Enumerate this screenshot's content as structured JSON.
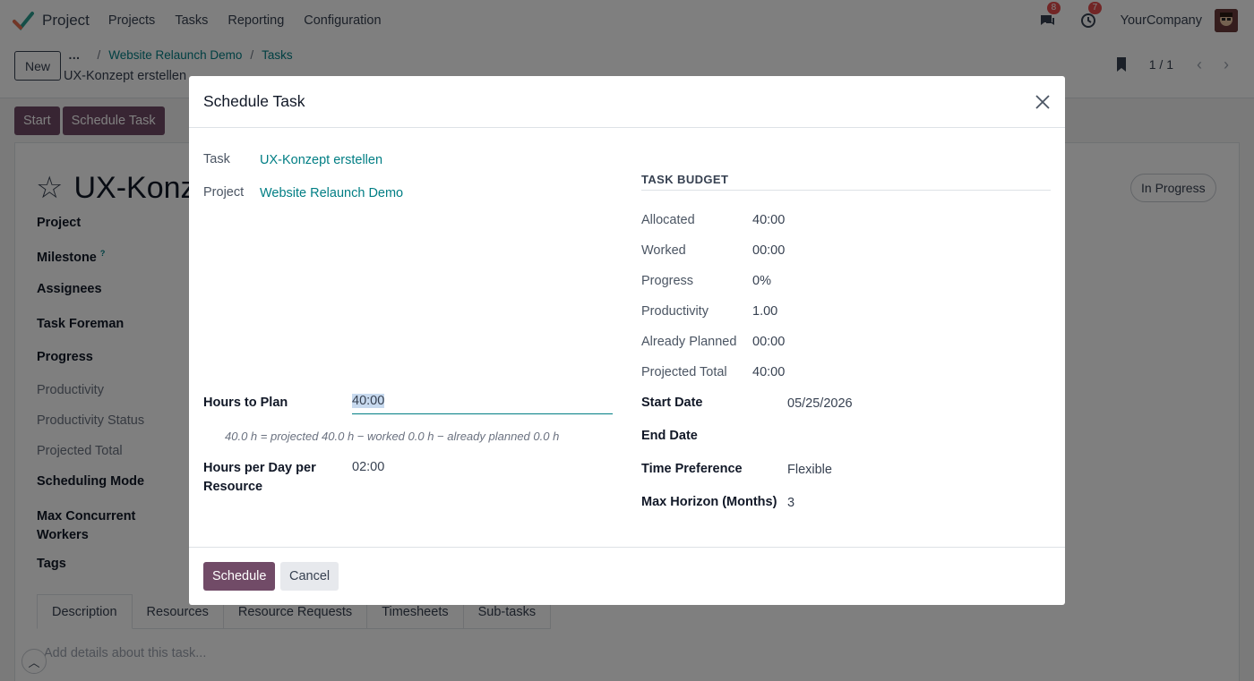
{
  "navbar": {
    "app_name": "Project",
    "menu": [
      "Projects",
      "Tasks",
      "Reporting",
      "Configuration"
    ],
    "messages_count": "8",
    "activities_count": "7",
    "company": "YourCompany"
  },
  "control_panel": {
    "new_label": "New",
    "breadcrumb_more": "…",
    "breadcrumbs": [
      "Website Relaunch Demo",
      "Tasks"
    ],
    "record_name": "UX-Konzept erstellen",
    "pager": "1 / 1"
  },
  "form": {
    "buttons": [
      "Start",
      "Schedule Task"
    ],
    "title": "UX-Konz",
    "status": "In Progress",
    "fields": [
      "Project",
      "Milestone",
      "Assignees",
      "Task Foreman",
      "Progress",
      "Productivity",
      "Productivity Status",
      "Projected Total",
      "Scheduling Mode",
      "Max Concurrent Workers",
      "Tags"
    ],
    "milestone_help": "?",
    "tabs": [
      "Description",
      "Resources",
      "Resource Requests",
      "Timesheets",
      "Sub-tasks"
    ],
    "description_placeholder": "Add details about this task..."
  },
  "dialog": {
    "title": "Schedule Task",
    "task_label": "Task",
    "task_value": "UX-Konzept erstellen",
    "project_label": "Project",
    "project_value": "Website Relaunch Demo",
    "hours_to_plan_label": "Hours to Plan",
    "hours_to_plan_value": "40:00",
    "hours_hint": "40.0 h = projected 40.0 h − worked 0.0 h − already planned 0.0 h",
    "hours_per_day_label": "Hours per Day per Resource",
    "hours_per_day_value": "02:00",
    "budget": {
      "heading": "TASK BUDGET",
      "rows": [
        {
          "label": "Allocated",
          "value": "40:00"
        },
        {
          "label": "Worked",
          "value": "00:00"
        },
        {
          "label": "Progress",
          "value": "0%"
        },
        {
          "label": "Productivity",
          "value": "1.00"
        },
        {
          "label": "Already Planned",
          "value": "00:00"
        },
        {
          "label": "Projected Total",
          "value": "40:00"
        }
      ]
    },
    "start_date_label": "Start Date",
    "start_date_value": "05/25/2026",
    "end_date_label": "End Date",
    "end_date_value": "",
    "time_pref_label": "Time Preference",
    "time_pref_value": "Flexible",
    "max_horizon_label": "Max Horizon (Months)",
    "max_horizon_value": "3",
    "schedule_label": "Schedule",
    "cancel_label": "Cancel"
  },
  "colors": {
    "primary": "#714b67",
    "link": "#017e84",
    "badge": "#e44d4d"
  }
}
